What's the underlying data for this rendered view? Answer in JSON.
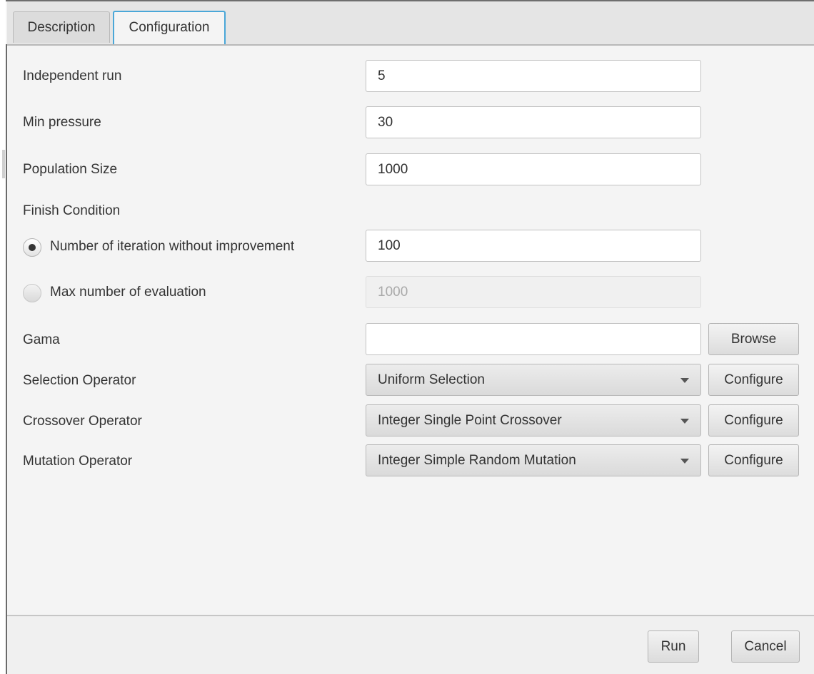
{
  "tabs": [
    {
      "label": "Description"
    },
    {
      "label": "Configuration"
    }
  ],
  "form": {
    "independent_run": {
      "label": "Independent run",
      "value": "5"
    },
    "min_pressure": {
      "label": "Min pressure",
      "value": "30"
    },
    "population_size": {
      "label": "Population Size",
      "value": "1000"
    },
    "finish_condition": {
      "label": "Finish Condition",
      "option_iterations": {
        "label": "Number of iteration without improvement",
        "selected": true,
        "value": "100"
      },
      "option_evaluations": {
        "label": "Max number of evaluation",
        "selected": false,
        "value": "1000"
      }
    },
    "gama": {
      "label": "Gama",
      "value": "",
      "browse_label": "Browse"
    },
    "selection_operator": {
      "label": "Selection Operator",
      "value": "Uniform Selection",
      "configure_label": "Configure"
    },
    "crossover_operator": {
      "label": "Crossover Operator",
      "value": "Integer Single Point Crossover",
      "configure_label": "Configure"
    },
    "mutation_operator": {
      "label": "Mutation Operator",
      "value": "Integer Simple Random Mutation",
      "configure_label": "Configure"
    }
  },
  "footer": {
    "run_label": "Run",
    "cancel_label": "Cancel"
  },
  "colors": {
    "tab_focus": "#4aa7d8",
    "background": "#f4f4f4"
  },
  "icons": {
    "dropdown": "chevron-down-icon"
  }
}
